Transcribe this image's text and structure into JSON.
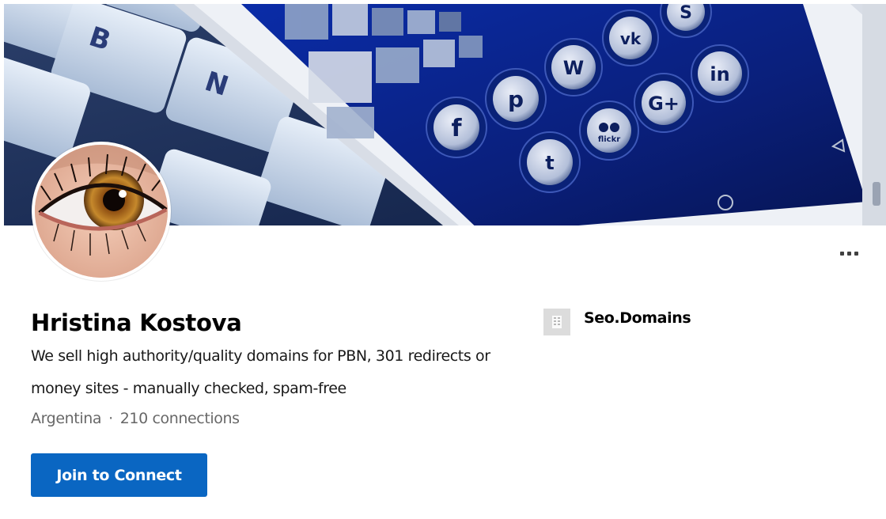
{
  "profile": {
    "name": "Hristina Kostova",
    "headline": "We sell high authority/quality domains for PBN, 301 redirects or money sites - manually checked, spam-free",
    "location": "Argentina",
    "separator": "·",
    "connections": "210 connections",
    "join_label": "Join to Connect"
  },
  "company": {
    "name": "Seo.Domains",
    "logo_icon": "building-icon"
  },
  "cover": {
    "description_icons": [
      "facebook-icon",
      "pinterest-icon",
      "wordpress-icon",
      "vk-icon",
      "skype-icon",
      "twitter-icon",
      "flickr-icon",
      "google-plus-icon",
      "linkedin-icon"
    ],
    "keyboard_keys": [
      "B",
      "N"
    ]
  },
  "colors": {
    "primary_button": "#0a66c2",
    "text_secondary": "#666666"
  }
}
